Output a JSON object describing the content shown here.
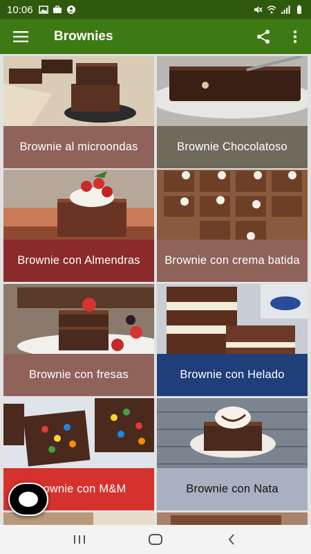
{
  "status_bar": {
    "time": "10:06",
    "left_icons": [
      "image-icon",
      "briefcase-icon",
      "account-icon"
    ],
    "right_icons": [
      "mute-icon",
      "wifi-icon",
      "signal-icon",
      "battery-icon"
    ]
  },
  "app_bar": {
    "title": "Brownies",
    "menu_icon": "hamburger-menu-icon",
    "share_icon": "share-icon",
    "more_icon": "more-vertical-icon"
  },
  "recipes": [
    {
      "label": "Brownie al microondas",
      "caption_color": "#8f635a"
    },
    {
      "label": "Brownie Chocolatoso",
      "caption_color": "#6f6b5b"
    },
    {
      "label": "Brownie con Almendras",
      "caption_color": "#8a2a2a"
    },
    {
      "label": "Brownie con crema batida",
      "caption_color": "#8f635a"
    },
    {
      "label": "Brownie con fresas",
      "caption_color": "#8f635a"
    },
    {
      "label": "Brownie con Helado",
      "caption_color": "#1f3f7a"
    },
    {
      "label": "Brownie con M&M",
      "caption_color": "#d6322d"
    },
    {
      "label": "Brownie con Nata",
      "caption_color": "#a9b0bf"
    }
  ],
  "fab": {
    "icon": "chat-bubble-icon"
  },
  "nav_bar": {
    "recent_icon": "recent-apps-icon",
    "home_icon": "home-icon",
    "back_icon": "back-icon"
  },
  "colors": {
    "status_bar": "#2f5a0d",
    "app_bar": "#3e7a13",
    "grid_background": "#e2e2e2"
  }
}
